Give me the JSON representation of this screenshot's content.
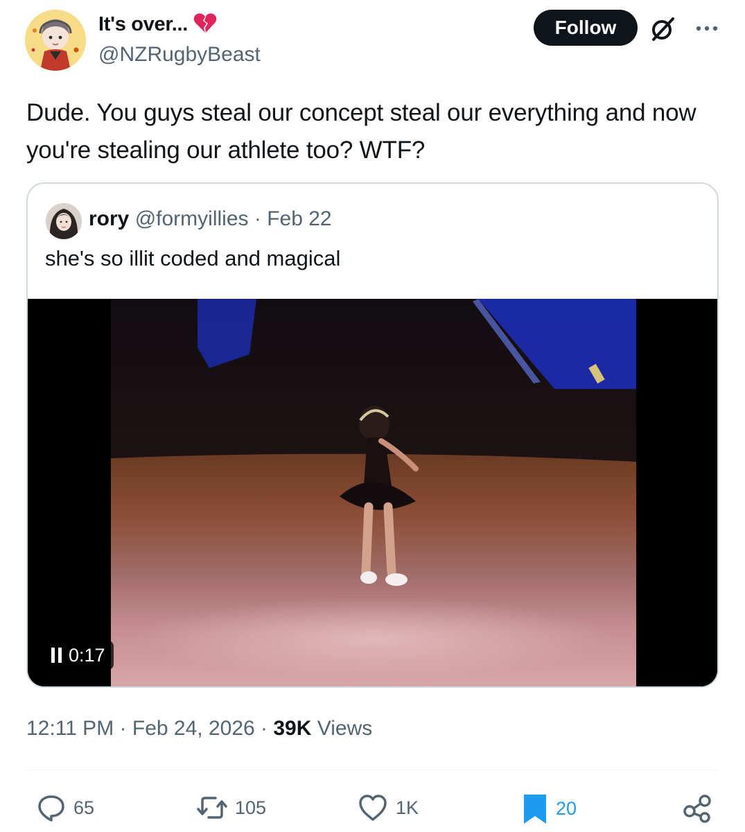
{
  "author": {
    "display_name": "It's over...",
    "handle": "@NZRugbyBeast"
  },
  "header": {
    "follow_label": "Follow"
  },
  "tweet": {
    "text": "Dude. You guys steal our concept steal our everything and now you're stealing our athlete too? WTF?"
  },
  "quote": {
    "name": "rory",
    "handle": "@formyillies",
    "separator": "·",
    "date": "Feb 22",
    "text": "she's so illit coded and magical",
    "video_time": "0:17"
  },
  "meta": {
    "time": "12:11 PM",
    "sep1": "·",
    "date": "Feb 24, 2026",
    "sep2": "·",
    "views_count": "39K",
    "views_label": "Views"
  },
  "actions": {
    "replies": "65",
    "reposts": "105",
    "likes": "1K",
    "bookmarks": "20"
  },
  "colors": {
    "text": "#0f1419",
    "secondary": "#536471",
    "bookmark_active": "#1d9bf0",
    "heartbreak": "#e0245e"
  },
  "icons": [
    "heartbreak-icon",
    "grok-icon",
    "more-icon",
    "pause-icon",
    "reply-icon",
    "repost-icon",
    "like-icon",
    "bookmark-icon",
    "share-icon"
  ]
}
